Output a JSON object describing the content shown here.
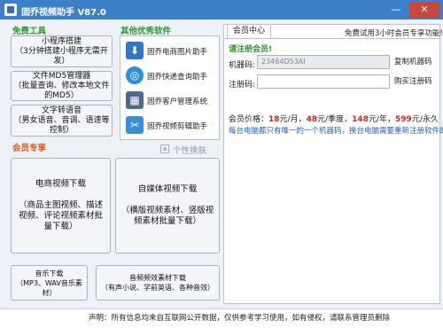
{
  "window": {
    "title": "固乔视频助手 V87.0",
    "minimize_glyph": "—",
    "close_glyph": "✕"
  },
  "free_tools": {
    "title": "免费工具",
    "buttons": [
      "小程序搭建\n（3分钟搭建小程序无需开发）",
      "文件MD5管理器\n（批量查询、修改本地文件的MD5）",
      "文字转语音\n（男女语音、音调、语速等控制）"
    ]
  },
  "other_software": {
    "title": "其他优秀软件",
    "items": [
      {
        "label": "固乔电商图片助手",
        "icon": "download-arrow-icon",
        "color": "#2f78c8",
        "glyph": "⬇"
      },
      {
        "label": "固乔快递查询助手",
        "icon": "express-circle-icon",
        "color": "#2f8fd8",
        "glyph": "◎"
      },
      {
        "label": "固乔客户管理系统",
        "icon": "grid-icon",
        "color": "#4a6a8f",
        "glyph": "▦"
      },
      {
        "label": "固乔视频剪辑助手",
        "icon": "scissors-icon",
        "color": "#3a8ed6",
        "glyph": "✂"
      }
    ]
  },
  "skin": {
    "label": "个性换肤"
  },
  "member": {
    "title": "会员专享",
    "big_buttons": [
      "电商视频下载\n\n（商品主图视频、描述视频、评论视频素材批量下载）",
      "自媒体视频下载\n\n（横版视频素材、竖版视频素材批量下载）"
    ],
    "small_buttons": [
      "音乐下载\n（MP3、WAV音乐素材）",
      "音频频效素材下载\n（有声小说、学前英语、各种音效）"
    ]
  },
  "member_center": {
    "tab": "会员中心",
    "promo": "免费试用3小时会员专享功能!",
    "register_hint": "请注册会员!",
    "machine_code_label": "机器码:",
    "machine_code_value": "23464D53AI",
    "copy_button": "复制机器码",
    "reg_code_label": "注册码:",
    "reg_code_value": "",
    "buy_button": "购买注册码",
    "price_label": "会员价格：",
    "prices": [
      {
        "amount": "18",
        "unit": "元/月，"
      },
      {
        "amount": "48",
        "unit": "元/季度，"
      },
      {
        "amount": "148",
        "unit": "元/年，"
      },
      {
        "amount": "599",
        "unit": "元/永久"
      }
    ],
    "note": "每台电脑都只有唯一的一个机器码，换台电脑需要重新注册软件的»"
  },
  "statusbar": {
    "text": "声明：所有信息均来自互联网公开数据，仅供参考学习使用，如有侵权，请联系管理员删除"
  },
  "colors": {
    "titlebar": "#3b80c8",
    "free_title": "#2c9a2f",
    "member_title": "#e3561f",
    "price": "#e02020",
    "note": "#1e63c4"
  }
}
